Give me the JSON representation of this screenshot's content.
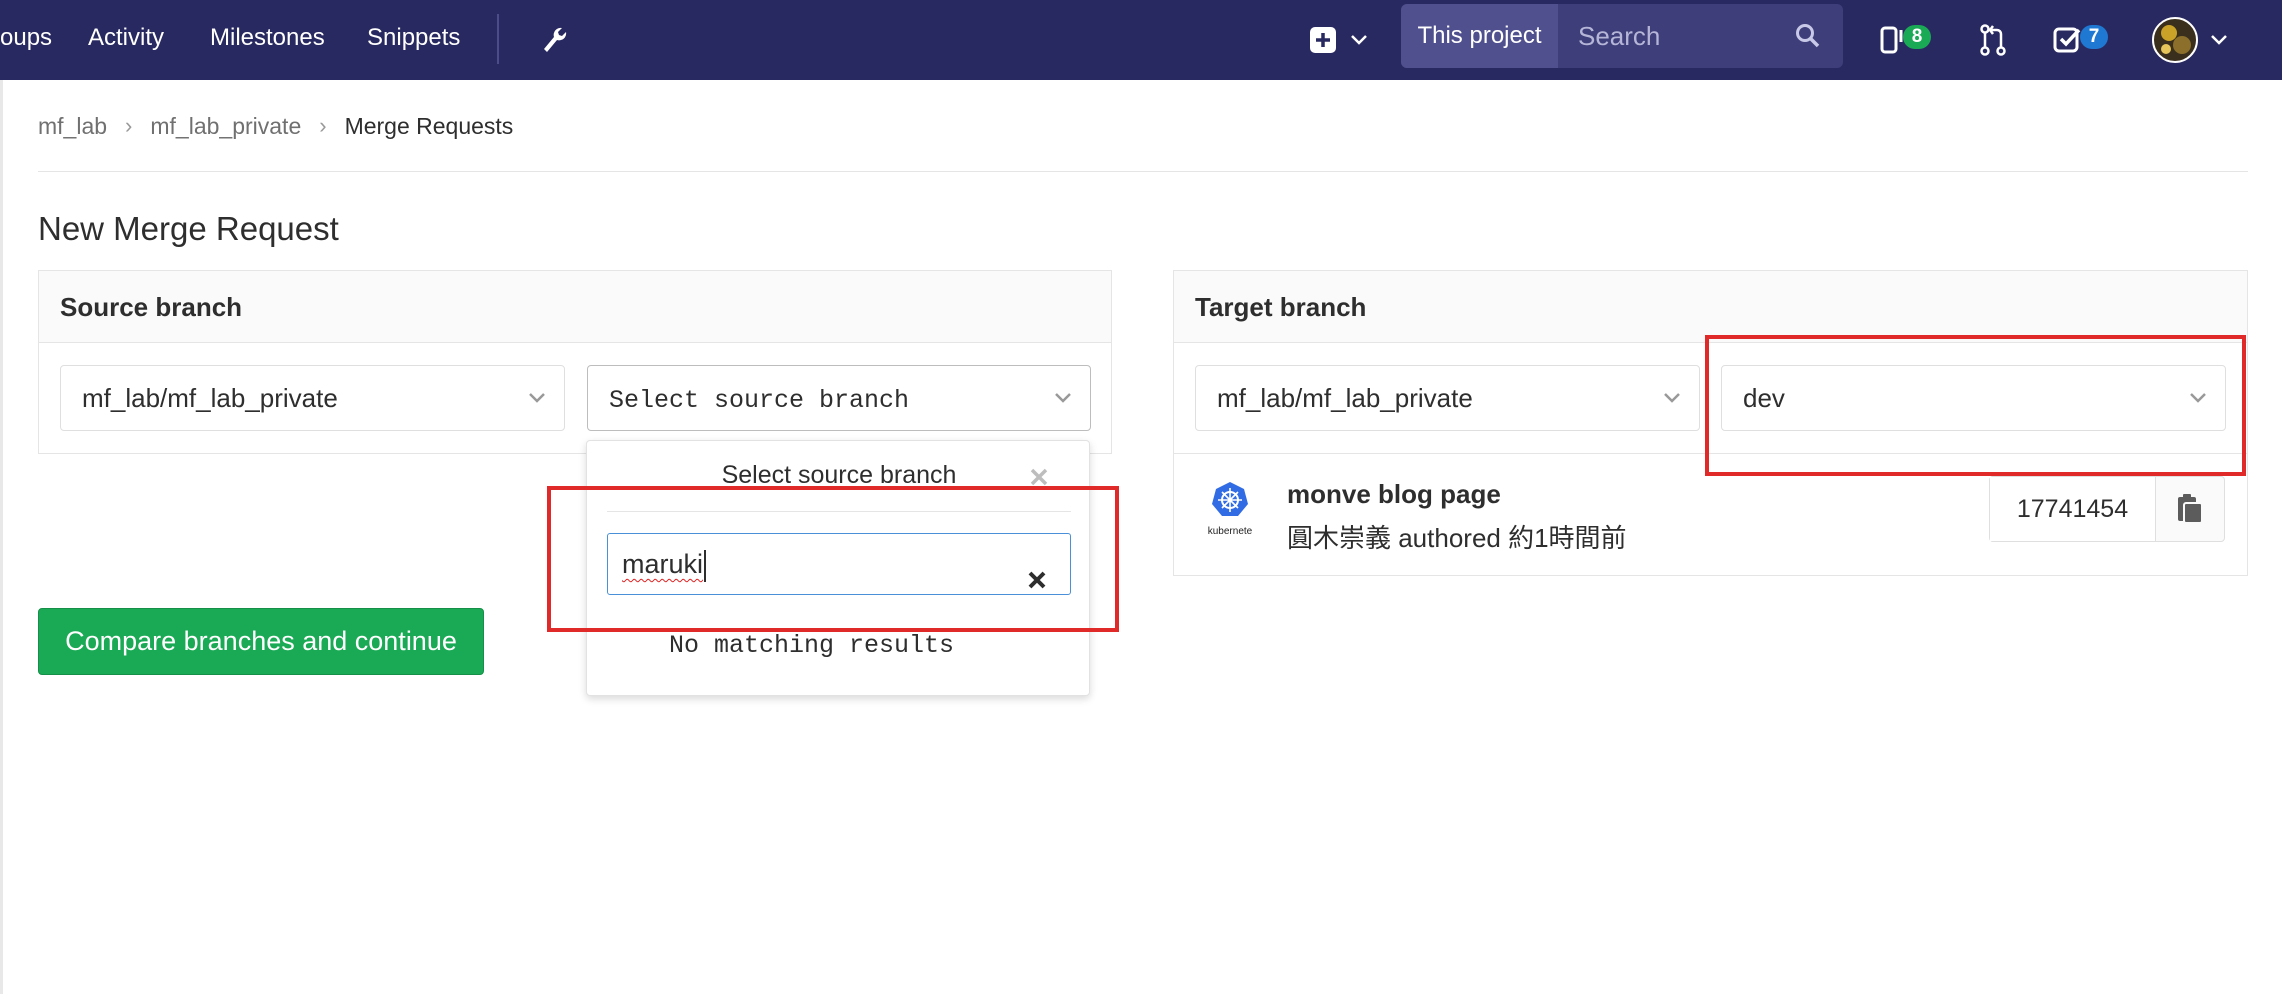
{
  "nav": {
    "links": [
      "oups",
      "Activity",
      "Milestones",
      "Snippets"
    ],
    "search_scope": "This project",
    "search_placeholder": "Search",
    "issues_count": "8",
    "todos_count": "7"
  },
  "breadcrumb": [
    "mf_lab",
    "mf_lab_private",
    "Merge Requests"
  ],
  "page_title": "New Merge Request",
  "source": {
    "heading": "Source branch",
    "project": "mf_lab/mf_lab_private",
    "branch_placeholder": "Select source branch"
  },
  "dropdown": {
    "title": "Select source branch",
    "search_value": "maruki",
    "empty_text": "No matching results"
  },
  "target": {
    "heading": "Target branch",
    "project": "mf_lab/mf_lab_private",
    "branch": "dev"
  },
  "commit": {
    "title": "monve blog page",
    "meta": "圓木崇義 authored 約1時間前",
    "sha": "17741454",
    "logo_text": "kubernete"
  },
  "compare_button": "Compare branches and continue",
  "colors": {
    "navbar": "#292961",
    "success": "#1aaa55",
    "highlight": "#e02a2a",
    "issues_badge": "#1aaa55",
    "todos_badge": "#1f78d1"
  }
}
